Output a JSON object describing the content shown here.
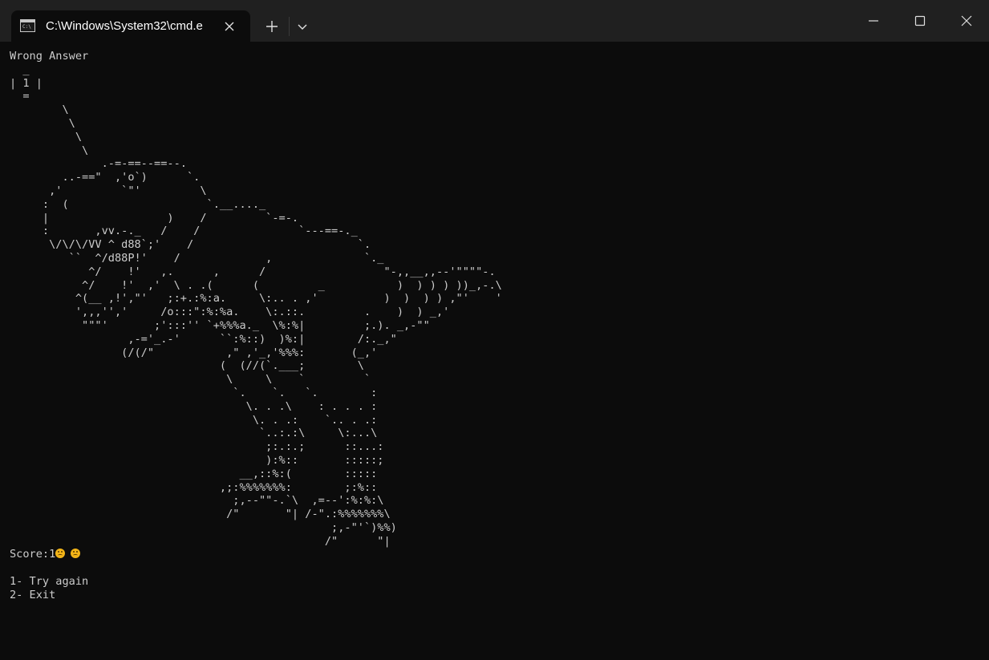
{
  "tab": {
    "title": "C:\\Windows\\System32\\cmd.e"
  },
  "icons": {
    "tab_icon": "terminal-icon",
    "close": "close-icon",
    "new_tab": "plus-icon",
    "dropdown": "chevron-down-icon",
    "minimize": "minimize-icon",
    "maximize": "maximize-icon",
    "window_close": "close-icon"
  },
  "console": {
    "line1": "Wrong Answer",
    "ascii_art": "  _\n| 1 |\n  =\n        \\\n         \\\n          \\\n           \\\n              .-=-==--==--.\n        ..-==\"  ,'o`)      `.\n      ,'         `\"'         \\\n     :  (                     `.__...._\n     |                  )    /         `-=-.\n     :       ,vv.-._   /    /               `---==-._\n      \\/\\/\\/VV ^ d88`;'    /                         `.\n         ``  ^/d88P!'    /             ,              `._\n            ^/    !'   ,.      ,      /                  \"-,,__,,--'\"\"\"\"-.\n           ^/    !'  ,'  \\ . .(      (         _           )  ) ) ) ))_,-.\\\n          ^(__ ,!',\"'   ;:+.:%:a.     \\:.. . ,'          )  )  ) ) ,\"'    '\n          ',,,'','     /o:::\":%:%a.    \\:.::.         .    )  ) _,'\n           \"\"\"'       ;':::'' `+%%%a._  \\%:%|         ;.). _,-\"\"\n                  ,-='_.-'      ``:%::)  )%:|        /:._,\"\n                 (/(/\"           ,\" ,'_,'%%%:       (_,'\n                                (  (//(`.___;        \\\n                                 \\     \\    `         `\n                                  `.    `.   `.        :\n                                    \\. . .\\    : . . . :\n                                     \\. . .:    `.. . .:\n                                      `..:.:\\     \\:...\\\n                                       ;:.:.;      ::...:\n                                       ):%::       :::::;\n                                   __,::%:(        :::::\n                                ,;:%%%%%%%:        ;:%::\n                                  ;,--\"\"-.`\\  ,=--':%:%:\\\n                                 /\"       \"| /-\".:%%%%%%%\\\n                                                 ;,-\"'`)%%)\n                                                /\"      \"|",
    "score_text": "Score:1",
    "option1": "1- Try again",
    "option2": "2- Exit"
  }
}
